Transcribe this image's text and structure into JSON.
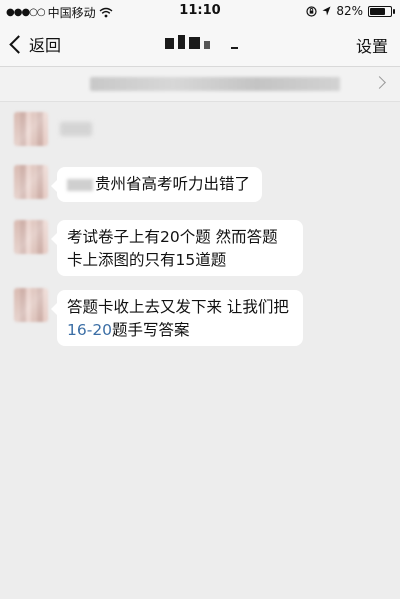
{
  "status_bar": {
    "carrier": "中国移动",
    "time": "11:10",
    "battery_percent": "82%",
    "battery_level": 0.82
  },
  "nav": {
    "back_label": "返回",
    "settings_label": "设置"
  },
  "messages": [
    {
      "text": "贵州省高考听力出错了"
    },
    {
      "text": "考试卷子上有20个题  然而答题卡上添图的只有15道题"
    },
    {
      "line1": "答题卡收上去又发下来  让我们把",
      "link": "16-20",
      "line2": "题手写答案"
    }
  ]
}
